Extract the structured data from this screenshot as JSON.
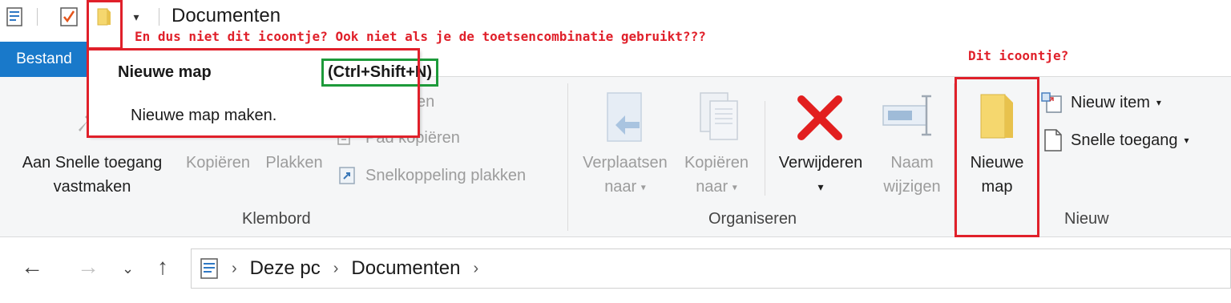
{
  "titlebar": {
    "title": "Documenten",
    "qa_buttons": [
      {
        "icon": "properties-icon"
      },
      {
        "icon": "checkmark-document-icon"
      },
      {
        "icon": "new-folder-icon"
      },
      {
        "icon": "customize-dropdown-icon"
      }
    ]
  },
  "tabs": {
    "file": "Bestand"
  },
  "tooltip": {
    "title": "Nieuwe map",
    "shortcut": "(Ctrl+Shift+N)",
    "description": "Nieuwe map maken."
  },
  "ribbon": {
    "klembord": {
      "label": "Klembord",
      "pin_line1": "Aan Snelle toegang",
      "pin_line2": "vastmaken",
      "copy": "Kopiëren",
      "paste": "Plakken",
      "cut_partial": "en",
      "copy_path": "Pad kopiëren",
      "paste_shortcut": "Snelkoppeling plakken"
    },
    "organiseren": {
      "label": "Organiseren",
      "move_line1": "Verplaatsen",
      "move_line2": "naar",
      "copyto_line1": "Kopiëren",
      "copyto_line2": "naar",
      "delete": "Verwijderen",
      "rename_line1": "Naam",
      "rename_line2": "wijzigen"
    },
    "nieuw": {
      "label": "Nieuw",
      "newfolder_line1": "Nieuwe",
      "newfolder_line2": "map",
      "new_item": "Nieuw item",
      "easy_access": "Snelle toegang"
    }
  },
  "addressbar": {
    "crumbs": [
      "Deze pc",
      "Documenten"
    ]
  },
  "annotations": {
    "left_note": "En dus niet dit icoontje? Ook niet als je de toetsencombinatie gebruikt???",
    "right_note": "Dit icoontje?"
  },
  "colors": {
    "accent": "#1979ca",
    "annotation_red": "#e0202a",
    "shortcut_green": "#1d9a3a",
    "delete_red": "#e21f1f",
    "folder_yellow": "#f5d76e"
  }
}
